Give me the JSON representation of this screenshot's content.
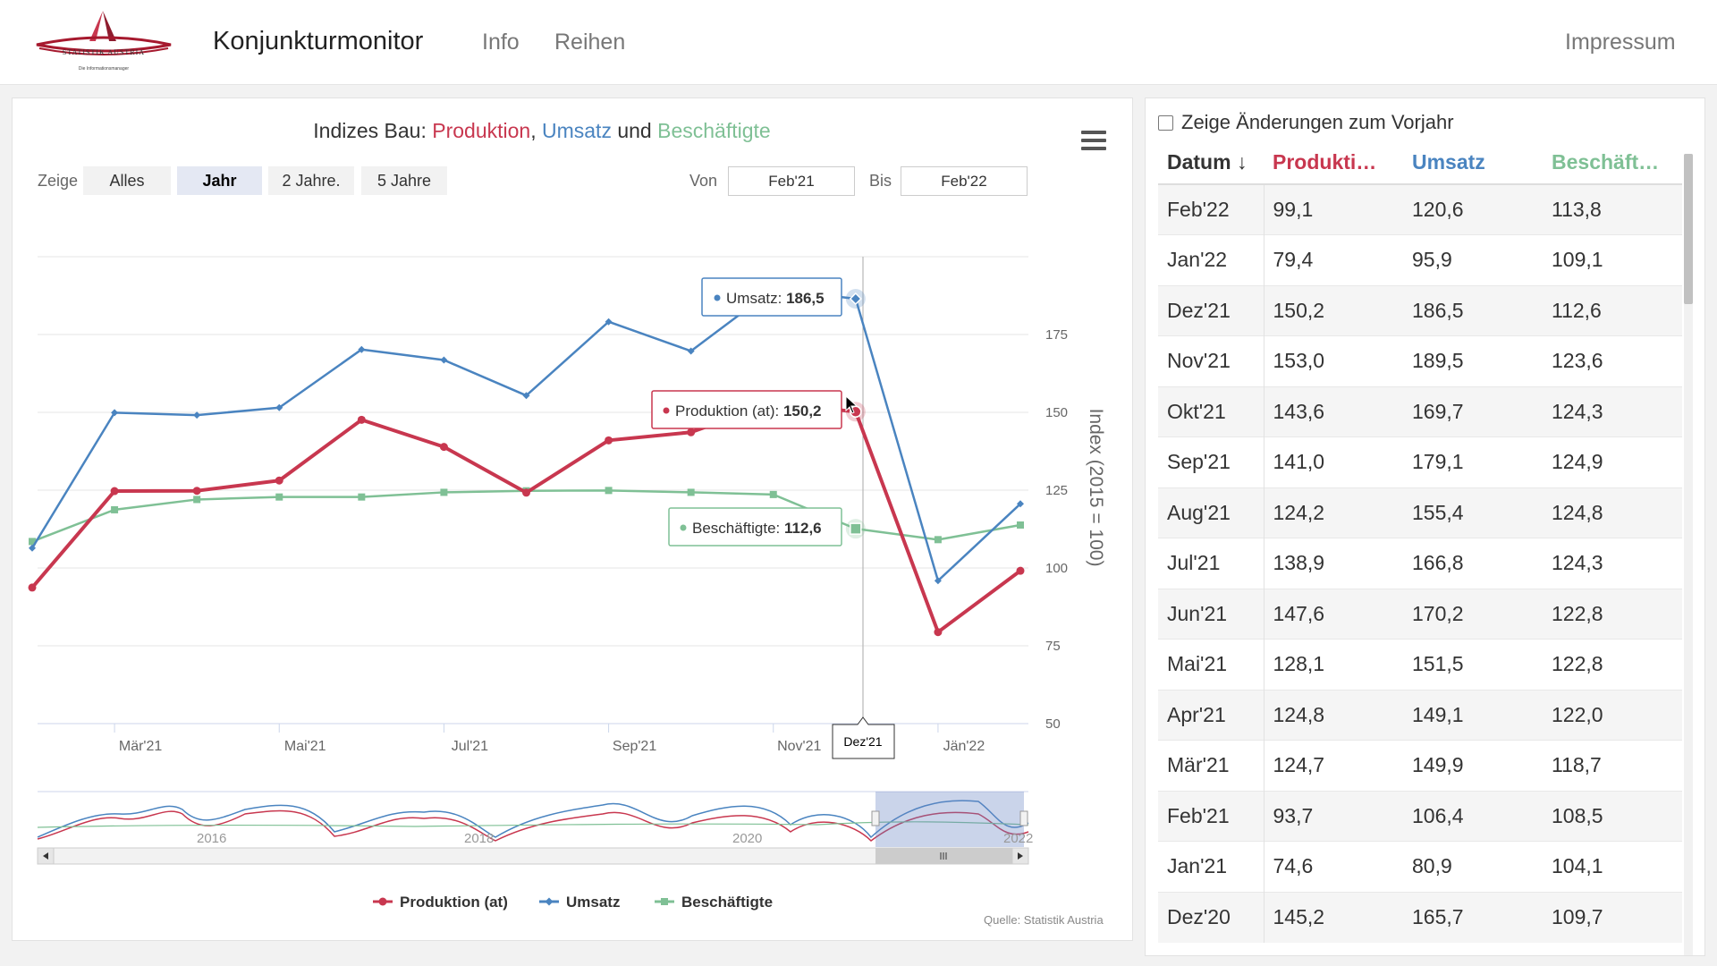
{
  "header": {
    "logo_text": "STATISTIK AUSTRIA",
    "logo_subtext": "Die Informationsmanager",
    "title": "Konjunkturmonitor",
    "nav": [
      "Info",
      "Reihen"
    ],
    "impressum": "Impressum"
  },
  "chart": {
    "title_prefix": "Indizes Bau: ",
    "title_part1": "Produktion",
    "title_sep1": ", ",
    "title_part2": "Umsatz",
    "title_sep2": " und ",
    "title_part3": "Beschäftigte",
    "range_label": "Zeige",
    "range_buttons": [
      "Alles",
      "Jahr",
      "2 Jahre.",
      "5 Jahre"
    ],
    "range_active": "Jahr",
    "from_label": "Von",
    "from_value": "Feb'21",
    "to_label": "Bis",
    "to_value": "Feb'22",
    "source": "Quelle: Statistik Austria",
    "tooltips": {
      "x": "Dez'21",
      "umsatz_label": "Umsatz: ",
      "umsatz_value": "186,5",
      "produktion_label": "Produktion (at): ",
      "produktion_value": "150,2",
      "besch_label": "Beschäftigte: ",
      "besch_value": "112,6"
    },
    "navigator_labels": [
      "2016",
      "2018",
      "2020",
      "2022"
    ]
  },
  "chart_data": {
    "type": "line",
    "categories": [
      "Feb'21",
      "Mär'21",
      "Apr'21",
      "Mai'21",
      "Jun'21",
      "Jul'21",
      "Aug'21",
      "Sep'21",
      "Okt'21",
      "Nov'21",
      "Dez'21",
      "Jän'22",
      "Feb'22"
    ],
    "x_tick_labels": [
      "Mär'21",
      "Mai'21",
      "Jul'21",
      "Sep'21",
      "Nov'21",
      "Jän'22"
    ],
    "series": [
      {
        "name": "Produktion (at)",
        "color": "#c8374f",
        "values": [
          93.7,
          124.7,
          124.8,
          128.1,
          147.6,
          138.9,
          124.2,
          141.0,
          143.6,
          153.0,
          150.2,
          79.4,
          99.1
        ]
      },
      {
        "name": "Umsatz",
        "color": "#4a84c0",
        "values": [
          106.4,
          149.9,
          149.1,
          151.5,
          170.2,
          166.8,
          155.4,
          179.1,
          169.7,
          189.5,
          186.5,
          95.9,
          120.6
        ]
      },
      {
        "name": "Beschäftigte",
        "color": "#7fc095",
        "values": [
          108.5,
          118.7,
          122.0,
          122.8,
          122.8,
          124.3,
          124.8,
          124.9,
          124.3,
          123.6,
          112.6,
          109.1,
          113.8
        ]
      }
    ],
    "ylabel": "Index (2015 = 100)",
    "yticks": [
      50,
      75,
      100,
      125,
      150,
      175
    ],
    "ylim": [
      50,
      200
    ],
    "grid": true,
    "legend": "bottom-center",
    "highlight_category": "Dez'21"
  },
  "table": {
    "yoy_label": "Zeige Änderungen zum Vorjahr",
    "columns": [
      "Datum ↓",
      "Produkti…",
      "Umsatz",
      "Beschäft…"
    ],
    "column_colors": [
      "#333333",
      "#c8374f",
      "#4a84c0",
      "#7fc095"
    ],
    "rows": [
      [
        "Feb'22",
        "99,1",
        "120,6",
        "113,8"
      ],
      [
        "Jan'22",
        "79,4",
        "95,9",
        "109,1"
      ],
      [
        "Dez'21",
        "150,2",
        "186,5",
        "112,6"
      ],
      [
        "Nov'21",
        "153,0",
        "189,5",
        "123,6"
      ],
      [
        "Okt'21",
        "143,6",
        "169,7",
        "124,3"
      ],
      [
        "Sep'21",
        "141,0",
        "179,1",
        "124,9"
      ],
      [
        "Aug'21",
        "124,2",
        "155,4",
        "124,8"
      ],
      [
        "Jul'21",
        "138,9",
        "166,8",
        "124,3"
      ],
      [
        "Jun'21",
        "147,6",
        "170,2",
        "122,8"
      ],
      [
        "Mai'21",
        "128,1",
        "151,5",
        "122,8"
      ],
      [
        "Apr'21",
        "124,8",
        "149,1",
        "122,0"
      ],
      [
        "Mär'21",
        "124,7",
        "149,9",
        "118,7"
      ],
      [
        "Feb'21",
        "93,7",
        "106,4",
        "108,5"
      ],
      [
        "Jan'21",
        "74,6",
        "80,9",
        "104,1"
      ],
      [
        "Dez'20",
        "145,2",
        "165,7",
        "109,7"
      ]
    ]
  }
}
